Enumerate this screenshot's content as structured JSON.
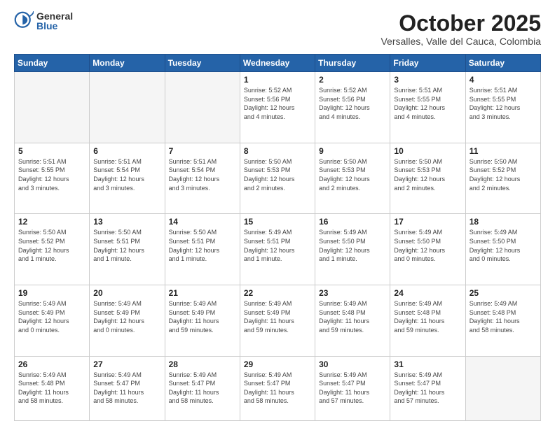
{
  "header": {
    "logo_general": "General",
    "logo_blue": "Blue",
    "title": "October 2025",
    "subtitle": "Versalles, Valle del Cauca, Colombia"
  },
  "days_of_week": [
    "Sunday",
    "Monday",
    "Tuesday",
    "Wednesday",
    "Thursday",
    "Friday",
    "Saturday"
  ],
  "weeks": [
    [
      {
        "day": "",
        "info": ""
      },
      {
        "day": "",
        "info": ""
      },
      {
        "day": "",
        "info": ""
      },
      {
        "day": "1",
        "info": "Sunrise: 5:52 AM\nSunset: 5:56 PM\nDaylight: 12 hours\nand 4 minutes."
      },
      {
        "day": "2",
        "info": "Sunrise: 5:52 AM\nSunset: 5:56 PM\nDaylight: 12 hours\nand 4 minutes."
      },
      {
        "day": "3",
        "info": "Sunrise: 5:51 AM\nSunset: 5:55 PM\nDaylight: 12 hours\nand 4 minutes."
      },
      {
        "day": "4",
        "info": "Sunrise: 5:51 AM\nSunset: 5:55 PM\nDaylight: 12 hours\nand 3 minutes."
      }
    ],
    [
      {
        "day": "5",
        "info": "Sunrise: 5:51 AM\nSunset: 5:55 PM\nDaylight: 12 hours\nand 3 minutes."
      },
      {
        "day": "6",
        "info": "Sunrise: 5:51 AM\nSunset: 5:54 PM\nDaylight: 12 hours\nand 3 minutes."
      },
      {
        "day": "7",
        "info": "Sunrise: 5:51 AM\nSunset: 5:54 PM\nDaylight: 12 hours\nand 3 minutes."
      },
      {
        "day": "8",
        "info": "Sunrise: 5:50 AM\nSunset: 5:53 PM\nDaylight: 12 hours\nand 2 minutes."
      },
      {
        "day": "9",
        "info": "Sunrise: 5:50 AM\nSunset: 5:53 PM\nDaylight: 12 hours\nand 2 minutes."
      },
      {
        "day": "10",
        "info": "Sunrise: 5:50 AM\nSunset: 5:53 PM\nDaylight: 12 hours\nand 2 minutes."
      },
      {
        "day": "11",
        "info": "Sunrise: 5:50 AM\nSunset: 5:52 PM\nDaylight: 12 hours\nand 2 minutes."
      }
    ],
    [
      {
        "day": "12",
        "info": "Sunrise: 5:50 AM\nSunset: 5:52 PM\nDaylight: 12 hours\nand 1 minute."
      },
      {
        "day": "13",
        "info": "Sunrise: 5:50 AM\nSunset: 5:51 PM\nDaylight: 12 hours\nand 1 minute."
      },
      {
        "day": "14",
        "info": "Sunrise: 5:50 AM\nSunset: 5:51 PM\nDaylight: 12 hours\nand 1 minute."
      },
      {
        "day": "15",
        "info": "Sunrise: 5:49 AM\nSunset: 5:51 PM\nDaylight: 12 hours\nand 1 minute."
      },
      {
        "day": "16",
        "info": "Sunrise: 5:49 AM\nSunset: 5:50 PM\nDaylight: 12 hours\nand 1 minute."
      },
      {
        "day": "17",
        "info": "Sunrise: 5:49 AM\nSunset: 5:50 PM\nDaylight: 12 hours\nand 0 minutes."
      },
      {
        "day": "18",
        "info": "Sunrise: 5:49 AM\nSunset: 5:50 PM\nDaylight: 12 hours\nand 0 minutes."
      }
    ],
    [
      {
        "day": "19",
        "info": "Sunrise: 5:49 AM\nSunset: 5:49 PM\nDaylight: 12 hours\nand 0 minutes."
      },
      {
        "day": "20",
        "info": "Sunrise: 5:49 AM\nSunset: 5:49 PM\nDaylight: 12 hours\nand 0 minutes."
      },
      {
        "day": "21",
        "info": "Sunrise: 5:49 AM\nSunset: 5:49 PM\nDaylight: 11 hours\nand 59 minutes."
      },
      {
        "day": "22",
        "info": "Sunrise: 5:49 AM\nSunset: 5:49 PM\nDaylight: 11 hours\nand 59 minutes."
      },
      {
        "day": "23",
        "info": "Sunrise: 5:49 AM\nSunset: 5:48 PM\nDaylight: 11 hours\nand 59 minutes."
      },
      {
        "day": "24",
        "info": "Sunrise: 5:49 AM\nSunset: 5:48 PM\nDaylight: 11 hours\nand 59 minutes."
      },
      {
        "day": "25",
        "info": "Sunrise: 5:49 AM\nSunset: 5:48 PM\nDaylight: 11 hours\nand 58 minutes."
      }
    ],
    [
      {
        "day": "26",
        "info": "Sunrise: 5:49 AM\nSunset: 5:48 PM\nDaylight: 11 hours\nand 58 minutes."
      },
      {
        "day": "27",
        "info": "Sunrise: 5:49 AM\nSunset: 5:47 PM\nDaylight: 11 hours\nand 58 minutes."
      },
      {
        "day": "28",
        "info": "Sunrise: 5:49 AM\nSunset: 5:47 PM\nDaylight: 11 hours\nand 58 minutes."
      },
      {
        "day": "29",
        "info": "Sunrise: 5:49 AM\nSunset: 5:47 PM\nDaylight: 11 hours\nand 58 minutes."
      },
      {
        "day": "30",
        "info": "Sunrise: 5:49 AM\nSunset: 5:47 PM\nDaylight: 11 hours\nand 57 minutes."
      },
      {
        "day": "31",
        "info": "Sunrise: 5:49 AM\nSunset: 5:47 PM\nDaylight: 11 hours\nand 57 minutes."
      },
      {
        "day": "",
        "info": ""
      }
    ]
  ]
}
